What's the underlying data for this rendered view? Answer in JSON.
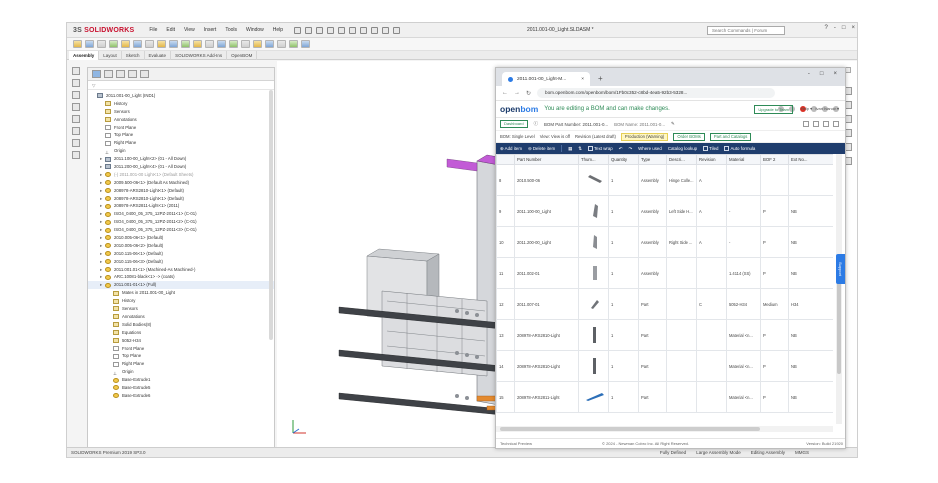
{
  "app": {
    "logo_brand": "3S",
    "logo_name": "SOLIDWORKS",
    "menu": [
      "File",
      "Edit",
      "View",
      "Insert",
      "Tools",
      "Window",
      "Help"
    ],
    "document_title": "2011.001-00_Light.SLDASM *",
    "search_placeholder": "Search Commands",
    "forum_label": "Forum",
    "window_controls": [
      "?",
      "-",
      "□",
      "×"
    ]
  },
  "command_tabs": [
    "Assembly",
    "Layout",
    "Sketch",
    "Evaluate",
    "SOLIDWORKS Add-Ins",
    "OpenBOM"
  ],
  "feature_manager": {
    "filter_label": "▽",
    "tree": [
      {
        "label": "2011.001-00_Light (IND1)",
        "icon": "asm",
        "indent": 0,
        "style": ""
      },
      {
        "label": "History",
        "icon": "folder",
        "indent": 1,
        "style": ""
      },
      {
        "label": "Sensors",
        "icon": "folder",
        "indent": 1,
        "style": ""
      },
      {
        "label": "Annotations",
        "icon": "folder",
        "indent": 1,
        "style": ""
      },
      {
        "label": "Front Plane",
        "icon": "plane",
        "indent": 1,
        "style": ""
      },
      {
        "label": "Top Plane",
        "icon": "plane",
        "indent": 1,
        "style": ""
      },
      {
        "label": "Right Plane",
        "icon": "plane",
        "indent": 1,
        "style": ""
      },
      {
        "label": "Origin",
        "icon": "origin",
        "indent": 1,
        "style": ""
      },
      {
        "label": "2011.100-00_Light<2> (01 - All Down)",
        "icon": "asm",
        "indent": 1,
        "style": ""
      },
      {
        "label": "2011.200-00_Light<4> (01 - All Down)",
        "icon": "asm",
        "indent": 1,
        "style": ""
      },
      {
        "label": "(-) 2011.001-00 Light<1> (Default Sheets)",
        "icon": "part",
        "indent": 1,
        "style": "grey"
      },
      {
        "label": "2009.500-06<1> (Default As Machined)",
        "icon": "part",
        "indent": 1,
        "style": ""
      },
      {
        "label": "208978-ARS2810-Light<1> (Default)",
        "icon": "part",
        "indent": 1,
        "style": ""
      },
      {
        "label": "208978-ARS2810-Light<1> (Default)",
        "icon": "part",
        "indent": 1,
        "style": ""
      },
      {
        "label": "208978-ARS2811-Light<1> (2011)",
        "icon": "part",
        "indent": 1,
        "style": ""
      },
      {
        "label": "ISO4_0400_05_375_12PZ-2011<1> (C-01)",
        "icon": "part",
        "indent": 1,
        "style": ""
      },
      {
        "label": "ISO4_0400_05_375_12PZ-2011<2> (C-01)",
        "icon": "part",
        "indent": 1,
        "style": ""
      },
      {
        "label": "ISO4_0400_05_375_12PZ-2011<3> (C-01)",
        "icon": "part",
        "indent": 1,
        "style": ""
      },
      {
        "label": "2010.005-06<1> (Default)",
        "icon": "part",
        "indent": 1,
        "style": ""
      },
      {
        "label": "2010.005-06<2> (Default)",
        "icon": "part",
        "indent": 1,
        "style": ""
      },
      {
        "label": "2010.115-06<1> (Default)",
        "icon": "part",
        "indent": 1,
        "style": ""
      },
      {
        "label": "2010.115-06<3> (Default)",
        "icon": "part",
        "indent": 1,
        "style": ""
      },
      {
        "label": "2011.001.01<1> (Machined-As Machined-)",
        "icon": "part",
        "indent": 1,
        "style": ""
      },
      {
        "label": "ARC.10081-black<1> -> (coats)",
        "icon": "part",
        "indent": 1,
        "style": ""
      },
      {
        "label": "2011.001-01<1> (Full)",
        "icon": "part",
        "indent": 1,
        "style": "hl"
      },
      {
        "label": "Mates in 2011.001-00_Light",
        "icon": "folder",
        "indent": 2,
        "style": ""
      },
      {
        "label": "History",
        "icon": "folder",
        "indent": 2,
        "style": ""
      },
      {
        "label": "Sensors",
        "icon": "folder",
        "indent": 2,
        "style": ""
      },
      {
        "label": "Annotations",
        "icon": "folder",
        "indent": 2,
        "style": ""
      },
      {
        "label": "Solid Bodies(8)",
        "icon": "folder",
        "indent": 2,
        "style": ""
      },
      {
        "label": "Equations",
        "icon": "folder",
        "indent": 2,
        "style": ""
      },
      {
        "label": "5052-H34",
        "icon": "folder",
        "indent": 2,
        "style": ""
      },
      {
        "label": "Front Plane",
        "icon": "plane",
        "indent": 2,
        "style": ""
      },
      {
        "label": "Top Plane",
        "icon": "plane",
        "indent": 2,
        "style": ""
      },
      {
        "label": "Right Plane",
        "icon": "plane",
        "indent": 2,
        "style": ""
      },
      {
        "label": "Origin",
        "icon": "origin",
        "indent": 2,
        "style": ""
      },
      {
        "label": "Base-Extrude1",
        "icon": "part",
        "indent": 2,
        "style": ""
      },
      {
        "label": "Base-Extrude5",
        "icon": "part",
        "indent": 2,
        "style": ""
      },
      {
        "label": "Base-Extrude6",
        "icon": "part",
        "indent": 2,
        "style": ""
      }
    ],
    "bottom_tabs": [
      "Model",
      "Motion Study 1"
    ]
  },
  "status_bar": {
    "left": "SOLIDWORKS Premium 2019 SP3.0",
    "items": [
      "Fully Defined",
      "Large Assembly Mode",
      "Editing Assembly",
      "MMGS"
    ]
  },
  "browser": {
    "tab_title": "2011.001-00_Light-M...",
    "url": "bom.openbom.com/openbom/bom/1Fb0c352-c8bd-4ea5-92b3-5328...",
    "window_controls": [
      "-",
      "□",
      "×"
    ]
  },
  "openbom": {
    "logo_a": "open",
    "logo_b": "bom",
    "message": "You are editing a BOM and can make changes.",
    "upgrade": "Upgrade to Team",
    "help": "Help",
    "user": "Ivan Ivanov",
    "dashboard": "Dashboard",
    "part_number": "BOM Part Number: 2011.001-0...",
    "bom_name": "BOM Name: 2011.001-0...",
    "options": [
      "BOM: Single Level",
      "View: View is off",
      "Revision (Latest draft)",
      "Production (Warning)",
      "Order BOMs",
      "Part and Catalogs"
    ],
    "toolbar": [
      "Add item",
      "Delete item",
      "Text wrap",
      "Where used",
      "Catalog lookup",
      "Tiled",
      "Auto formula"
    ],
    "columns": [
      "",
      "Part Number",
      "Thum...",
      "Quantity",
      "Type",
      "Descri...",
      "Revision",
      "Material",
      "BOF 2",
      "Ext No..."
    ],
    "rows": [
      {
        "idx": "8",
        "pn": "2010.500-06",
        "qty": "1",
        "type": "Assembly",
        "desc": "Hinge Colle...",
        "rev": "A",
        "mat": "",
        "bof": "",
        "ext": ""
      },
      {
        "idx": "9",
        "pn": "2011.100-00_Light",
        "qty": "1",
        "type": "Assembly",
        "desc": "Left Side H...",
        "rev": "A",
        "mat": "-",
        "bof": "P",
        "ext": "NB"
      },
      {
        "idx": "10",
        "pn": "2011.200-00_Light",
        "qty": "1",
        "type": "Assembly",
        "desc": "Right Side ...",
        "rev": "A",
        "mat": "-",
        "bof": "P",
        "ext": "NB"
      },
      {
        "idx": "11",
        "pn": "2011.002-01",
        "qty": "1",
        "type": "Assembly",
        "desc": "",
        "rev": "",
        "mat": "1.4114 (SS)",
        "bof": "P",
        "ext": "NB"
      },
      {
        "idx": "12",
        "pn": "2011.007-01",
        "qty": "1",
        "type": "Part",
        "desc": "",
        "rev": "C",
        "mat": "5052-H34",
        "bof": "Medium",
        "ext": "H34"
      },
      {
        "idx": "13",
        "pn": "208978-ARS2810-Light",
        "qty": "1",
        "type": "Part",
        "desc": "",
        "rev": "",
        "mat": "Material <n...",
        "bof": "P",
        "ext": "NB"
      },
      {
        "idx": "14",
        "pn": "208978-ARS2810-Light",
        "qty": "1",
        "type": "Part",
        "desc": "",
        "rev": "",
        "mat": "Material <n...",
        "bof": "P",
        "ext": "NB"
      },
      {
        "idx": "15",
        "pn": "208978-ARS2811-Light",
        "qty": "1",
        "type": "Part",
        "desc": "",
        "rev": "",
        "mat": "Material <n...",
        "bof": "P",
        "ext": "NB"
      }
    ],
    "footer_left": "Technical Preview",
    "footer_center": "© 2024 - Newman Cobro Inc. All Right Reserved.",
    "footer_right": "Version: Build 21920",
    "side_tab": "Support"
  },
  "colors": {
    "accent": "#2c7be5",
    "brand": "#c8102e",
    "toolbar": "#1f3d6d",
    "green": "#2e8b57"
  }
}
